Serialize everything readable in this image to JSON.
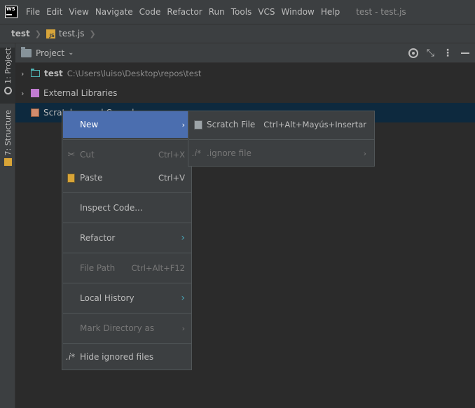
{
  "app": {
    "logo_text": "WS"
  },
  "menubar": {
    "items": [
      "File",
      "Edit",
      "View",
      "Navigate",
      "Code",
      "Refactor",
      "Run",
      "Tools",
      "VCS",
      "Window",
      "Help"
    ],
    "window_title": "test - test.js"
  },
  "breadcrumb": {
    "project": "test",
    "file": "test.js",
    "file_icon_text": "JS"
  },
  "stripe": {
    "project_label": "1: Project",
    "structure_label": "7: Structure"
  },
  "project_panel": {
    "title": "Project"
  },
  "tree": {
    "items": [
      {
        "name": "test",
        "path": "C:\\Users\\luiso\\Desktop\\repos\\test"
      },
      {
        "name": "External Libraries"
      },
      {
        "name": "Scratches and Consoles"
      }
    ]
  },
  "context_menu": {
    "items": [
      {
        "label": "New",
        "shortcut": "",
        "submenu": true
      },
      {
        "label": "Cut",
        "shortcut": "Ctrl+X"
      },
      {
        "label": "Paste",
        "shortcut": "Ctrl+V"
      },
      {
        "label": "Inspect Code...",
        "shortcut": ""
      },
      {
        "label": "Refactor",
        "shortcut": "",
        "submenu": true
      },
      {
        "label": "File Path",
        "shortcut": "Ctrl+Alt+F12"
      },
      {
        "label": "Local History",
        "shortcut": "",
        "submenu": true
      },
      {
        "label": "Mark Directory as",
        "shortcut": "",
        "submenu": true
      },
      {
        "label": "Hide ignored files",
        "shortcut": "",
        "icon_text": ".i*"
      }
    ]
  },
  "submenu": {
    "items": [
      {
        "label": "Scratch File",
        "shortcut": "Ctrl+Alt+Mayús+Insertar"
      },
      {
        "label": ".ignore file",
        "icon_text": ".i*"
      }
    ]
  },
  "colors": {
    "background": "#2b2b2b",
    "panel": "#3c3f41",
    "selection": "#4b6eaf",
    "tree_selection": "#0d293e"
  }
}
